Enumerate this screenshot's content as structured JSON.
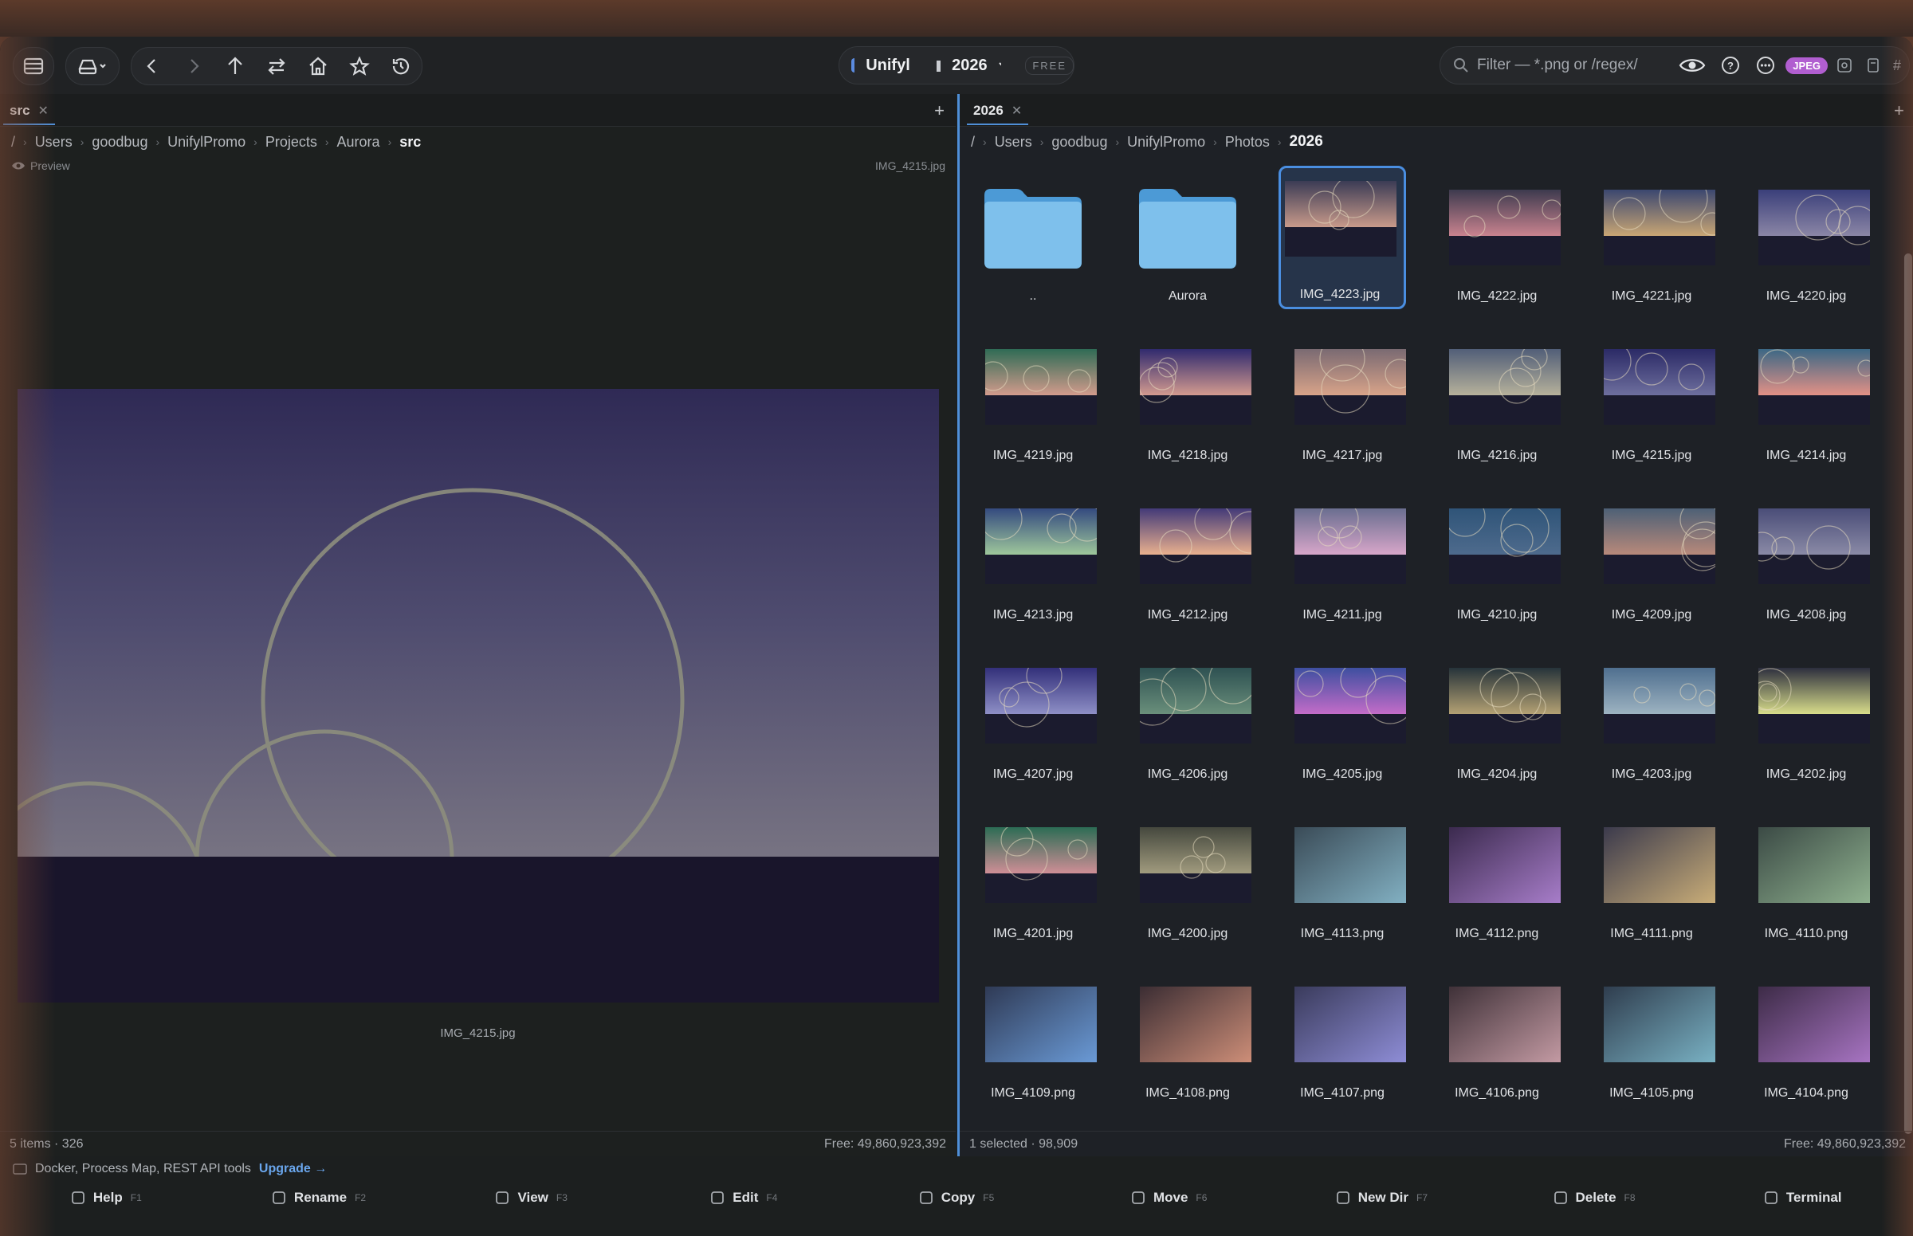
{
  "toolbar": {
    "app_name": "Unifyl",
    "folder": "2026",
    "badge": "FREE",
    "filter_placeholder": "Filter — *.png or /regex/",
    "format_badge": "JPEG",
    "hash": "#"
  },
  "left": {
    "tab": "src",
    "crumbs": [
      "/",
      "Users",
      "goodbug",
      "UnifylPromo",
      "Projects",
      "Aurora",
      "src"
    ],
    "preview_label": "Preview",
    "preview_file": "IMG_4215.jpg",
    "caption": "IMG_4215.jpg",
    "status_left": "5 items · 326",
    "status_right": "Free: 49,860,923,392"
  },
  "right": {
    "tab": "2026",
    "crumbs": [
      "/",
      "Users",
      "goodbug",
      "UnifylPromo",
      "Photos",
      "2026"
    ],
    "status_left": "1 selected · 98,909",
    "status_right": "Free: 49,860,923,392",
    "items": [
      {
        "name": "..",
        "kind": "folder"
      },
      {
        "name": "Aurora",
        "kind": "folder"
      },
      {
        "name": "IMG_4223.jpg",
        "selected": true,
        "colors": [
          "#3b3b55",
          "#c89a8a"
        ]
      },
      {
        "name": "IMG_4222.jpg",
        "colors": [
          "#3d3a4e",
          "#c9838f"
        ]
      },
      {
        "name": "IMG_4221.jpg",
        "colors": [
          "#3b4770",
          "#c9a674"
        ]
      },
      {
        "name": "IMG_4220.jpg",
        "colors": [
          "#3a3f7a",
          "#8b86a6"
        ]
      },
      {
        "name": "IMG_4219.jpg",
        "colors": [
          "#2f6b55",
          "#d29b8c"
        ]
      },
      {
        "name": "IMG_4218.jpg",
        "colors": [
          "#302a6e",
          "#d39a8f"
        ]
      },
      {
        "name": "IMG_4217.jpg",
        "colors": [
          "#7a6a72",
          "#d8a389"
        ]
      },
      {
        "name": "IMG_4216.jpg",
        "colors": [
          "#515e78",
          "#b6b19b"
        ]
      },
      {
        "name": "IMG_4215.jpg",
        "colors": [
          "#2b2a66",
          "#6e6f9e"
        ]
      },
      {
        "name": "IMG_4214.jpg",
        "colors": [
          "#3b6785",
          "#e39186"
        ]
      },
      {
        "name": "IMG_4213.jpg",
        "colors": [
          "#344a7f",
          "#9ec79b"
        ]
      },
      {
        "name": "IMG_4212.jpg",
        "colors": [
          "#433a78",
          "#e9b08e"
        ]
      },
      {
        "name": "IMG_4211.jpg",
        "colors": [
          "#6a6e8f",
          "#d7a6c9"
        ]
      },
      {
        "name": "IMG_4210.jpg",
        "colors": [
          "#2f5478",
          "#4e6b8d"
        ]
      },
      {
        "name": "IMG_4209.jpg",
        "colors": [
          "#4d6076",
          "#b8897a"
        ]
      },
      {
        "name": "IMG_4208.jpg",
        "colors": [
          "#4a4d78",
          "#8a8aa6"
        ]
      },
      {
        "name": "IMG_4207.jpg",
        "colors": [
          "#33307a",
          "#8e8fc6"
        ]
      },
      {
        "name": "IMG_4206.jpg",
        "colors": [
          "#2e5152",
          "#6a8f7b"
        ]
      },
      {
        "name": "IMG_4205.jpg",
        "colors": [
          "#3e4fa0",
          "#c36cc8"
        ]
      },
      {
        "name": "IMG_4204.jpg",
        "colors": [
          "#26333a",
          "#b4a173"
        ]
      },
      {
        "name": "IMG_4203.jpg",
        "colors": [
          "#4f6f8f",
          "#9db3c1"
        ]
      },
      {
        "name": "IMG_4202.jpg",
        "colors": [
          "#2d2f3e",
          "#d8dd8a"
        ]
      },
      {
        "name": "IMG_4201.jpg",
        "colors": [
          "#2c6c54",
          "#cf8e96"
        ]
      },
      {
        "name": "IMG_4200.jpg",
        "colors": [
          "#45483e",
          "#a19b7e"
        ]
      },
      {
        "name": "IMG_4113.png",
        "colors": [
          "#3a4b57",
          "#82b0c2"
        ]
      },
      {
        "name": "IMG_4112.png",
        "colors": [
          "#3b2a4e",
          "#a77dc9"
        ]
      },
      {
        "name": "IMG_4111.png",
        "colors": [
          "#3b3a4c",
          "#c9ad78"
        ]
      },
      {
        "name": "IMG_4110.png",
        "colors": [
          "#3b4a45",
          "#8fb18f"
        ]
      },
      {
        "name": "IMG_4109.png",
        "colors": [
          "#2f3a55",
          "#6a9ad6"
        ]
      },
      {
        "name": "IMG_4108.png",
        "colors": [
          "#3b2d33",
          "#cd8e78"
        ]
      },
      {
        "name": "IMG_4107.png",
        "colors": [
          "#3a3b5c",
          "#8e8dd6"
        ]
      },
      {
        "name": "IMG_4106.png",
        "colors": [
          "#3f3138",
          "#c39aa3"
        ]
      },
      {
        "name": "IMG_4105.png",
        "colors": [
          "#2f3d4e",
          "#79b1c3"
        ]
      },
      {
        "name": "IMG_4104.png",
        "colors": [
          "#3d2b47",
          "#a774c2"
        ]
      }
    ]
  },
  "promo": {
    "text": "Docker, Process Map, REST API tools",
    "link": "Upgrade →"
  },
  "fkeys": [
    {
      "label": "Help",
      "key": "F1",
      "icon": "help-icon"
    },
    {
      "label": "Rename",
      "key": "F2",
      "icon": "pencil-icon"
    },
    {
      "label": "View",
      "key": "F3",
      "icon": "eye-icon"
    },
    {
      "label": "Edit",
      "key": "F4",
      "icon": "edit-icon"
    },
    {
      "label": "Copy",
      "key": "F5",
      "icon": "copy-icon"
    },
    {
      "label": "Move",
      "key": "F6",
      "icon": "move-icon"
    },
    {
      "label": "New Dir",
      "key": "F7",
      "icon": "folder-plus-icon"
    },
    {
      "label": "Delete",
      "key": "F8",
      "icon": "trash-icon"
    },
    {
      "label": "Terminal",
      "key": "",
      "icon": "terminal-icon"
    }
  ]
}
